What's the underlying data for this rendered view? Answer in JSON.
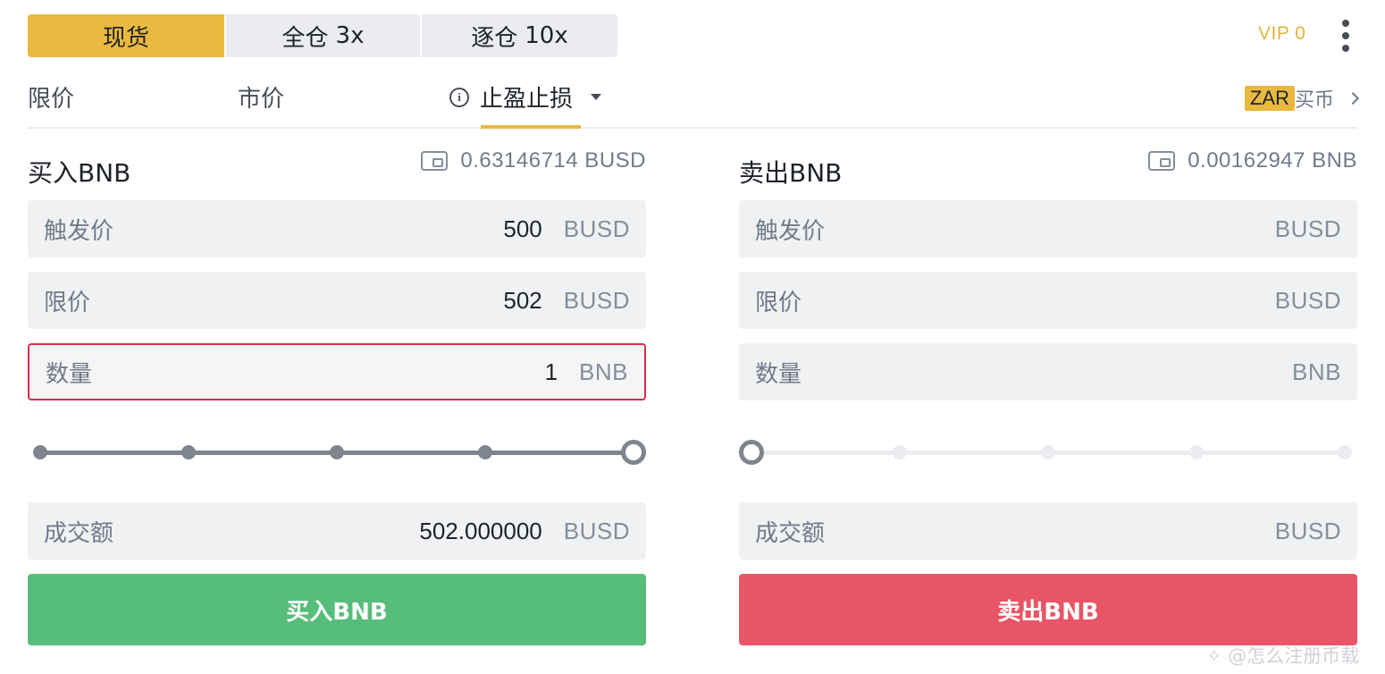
{
  "mode_tabs": {
    "spot": "现货",
    "cross": "全仓",
    "cross_leverage": "3x",
    "isolated": "逐仓",
    "isolated_leverage": "10x"
  },
  "vip_label": "VIP 0",
  "order_tabs": {
    "limit": "限价",
    "market": "市价",
    "stop_limit": "止盈止损"
  },
  "buy_coin": {
    "currency": "ZAR",
    "label": "买币"
  },
  "buy_panel": {
    "title": "买入BNB",
    "balance": "0.63146714 BUSD",
    "trigger_label": "触发价",
    "trigger_value": "500",
    "trigger_unit": "BUSD",
    "limit_label": "限价",
    "limit_value": "502",
    "limit_unit": "BUSD",
    "amount_label": "数量",
    "amount_value": "1",
    "amount_unit": "BNB",
    "slider_percent": 100,
    "total_label": "成交额",
    "total_value": "502.000000",
    "total_unit": "BUSD",
    "button": "买入BNB"
  },
  "sell_panel": {
    "title": "卖出BNB",
    "balance": "0.00162947 BNB",
    "trigger_label": "触发价",
    "trigger_unit": "BUSD",
    "limit_label": "限价",
    "limit_unit": "BUSD",
    "amount_label": "数量",
    "amount_unit": "BNB",
    "slider_percent": 0,
    "total_label": "成交额",
    "total_unit": "BUSD",
    "button": "卖出BNB"
  },
  "watermark": "✧ @怎么注册币载",
  "colors": {
    "accent_yellow": "#e9b93f",
    "buy_green": "#57bd7a",
    "sell_red": "#e75566",
    "error_border": "#cf304a"
  }
}
